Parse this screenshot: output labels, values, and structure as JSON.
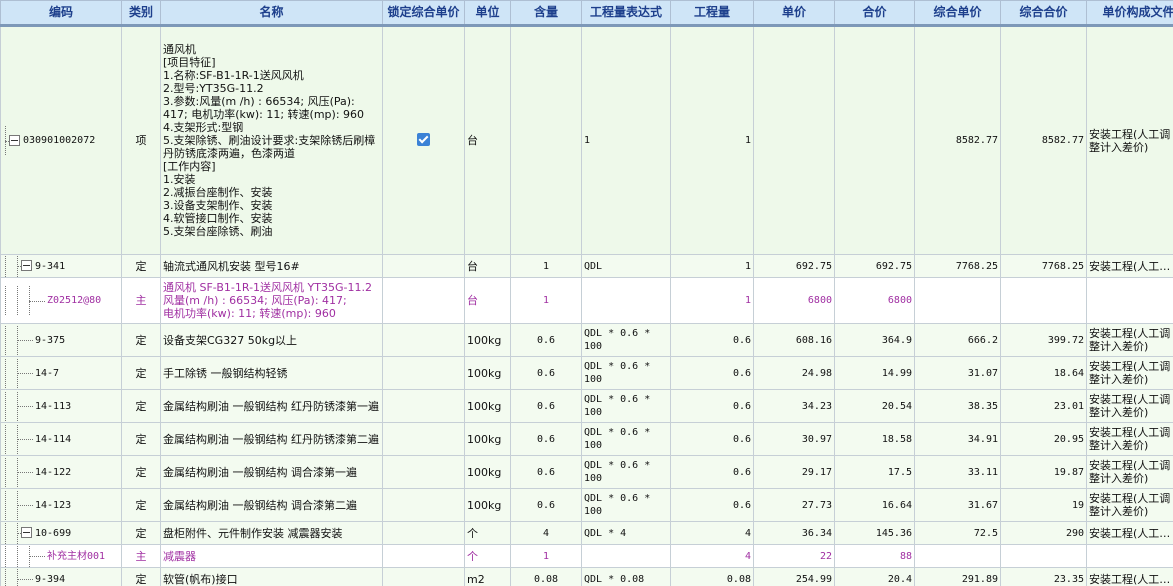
{
  "headers": [
    "编码",
    "类别",
    "名称",
    "锁定综合单价",
    "单位",
    "含量",
    "工程量表达式",
    "工程量",
    "单价",
    "合价",
    "综合单价",
    "综合合价",
    "单价构成文件"
  ],
  "rows": [
    {
      "code": "030901002072",
      "type": "项",
      "name": "通风机\n[项目特征]\n1.名称:SF-B1-1R-1送风风机\n2.型号:YT35G-11.2\n3.参数:风量(m /h)  : 66534; 风压(Pa): 417;  电机功率(kw): 11; 转速(mp): 960\n4.支架形式:型钢\n5.支架除锈、刷油设计要求:支架除锈后刷樟丹防锈底漆两遍，色漆两道\n[工作内容]\n1.安装\n2.减振台座制作、安装\n3.设备支架制作、安装\n4.软管接口制作、安装\n5.支架台座除锈、刷油",
      "unit": "台",
      "content": "",
      "expr": "1",
      "qty": "1",
      "price": "",
      "total": "",
      "comp_price": "8582.77",
      "comp_total": "8582.77",
      "file": "安装工程(人工调\n整计入差价)",
      "locked": true
    },
    {
      "code": "9-341",
      "type": "定",
      "name": "轴流式通风机安装 型号16#",
      "unit": "台",
      "content": "1",
      "expr": "QDL",
      "qty": "1",
      "price": "692.75",
      "total": "692.75",
      "comp_price": "7768.25",
      "comp_total": "7768.25",
      "file": "安装工程(人工…"
    },
    {
      "code": "Z02512@80",
      "type": "主",
      "name": "通风机 SF-B1-1R-1送风风机 YT35G-11.2\n风量(m /h)  : 66534; 风压(Pa): 417;\n电机功率(kw): 11; 转速(mp): 960",
      "unit": "台",
      "content": "1",
      "expr": "",
      "qty": "1",
      "price": "6800",
      "total": "6800",
      "comp_price": "",
      "comp_total": "",
      "file": ""
    },
    {
      "code": "9-375",
      "type": "定",
      "name": "设备支架CG327 50kg以上",
      "unit": "100kg",
      "content": "0.6",
      "expr": "QDL * 0.6 *\n100",
      "qty": "0.6",
      "price": "608.16",
      "total": "364.9",
      "comp_price": "666.2",
      "comp_total": "399.72",
      "file": "安装工程(人工调\n整计入差价)"
    },
    {
      "code": "14-7",
      "type": "定",
      "name": "手工除锈 一般钢结构轻锈",
      "unit": "100kg",
      "content": "0.6",
      "expr": "QDL * 0.6 *\n100",
      "qty": "0.6",
      "price": "24.98",
      "total": "14.99",
      "comp_price": "31.07",
      "comp_total": "18.64",
      "file": "安装工程(人工调\n整计入差价)"
    },
    {
      "code": "14-113",
      "type": "定",
      "name": "金属结构刷油 一般钢结构 红丹防锈漆第一遍",
      "unit": "100kg",
      "content": "0.6",
      "expr": "QDL * 0.6 *\n100",
      "qty": "0.6",
      "price": "34.23",
      "total": "20.54",
      "comp_price": "38.35",
      "comp_total": "23.01",
      "file": "安装工程(人工调\n整计入差价)"
    },
    {
      "code": "14-114",
      "type": "定",
      "name": "金属结构刷油 一般钢结构 红丹防锈漆第二遍",
      "unit": "100kg",
      "content": "0.6",
      "expr": "QDL * 0.6 *\n100",
      "qty": "0.6",
      "price": "30.97",
      "total": "18.58",
      "comp_price": "34.91",
      "comp_total": "20.95",
      "file": "安装工程(人工调\n整计入差价)"
    },
    {
      "code": "14-122",
      "type": "定",
      "name": "金属结构刷油 一般钢结构 调合漆第一遍",
      "unit": "100kg",
      "content": "0.6",
      "expr": "QDL * 0.6 *\n100",
      "qty": "0.6",
      "price": "29.17",
      "total": "17.5",
      "comp_price": "33.11",
      "comp_total": "19.87",
      "file": "安装工程(人工调\n整计入差价)"
    },
    {
      "code": "14-123",
      "type": "定",
      "name": "金属结构刷油 一般钢结构 调合漆第二遍",
      "unit": "100kg",
      "content": "0.6",
      "expr": "QDL * 0.6 *\n100",
      "qty": "0.6",
      "price": "27.73",
      "total": "16.64",
      "comp_price": "31.67",
      "comp_total": "19",
      "file": "安装工程(人工调\n整计入差价)"
    },
    {
      "code": "10-699",
      "type": "定",
      "name": "盘柜附件、元件制作安装 减震器安装",
      "unit": "个",
      "content": "4",
      "expr": "QDL * 4",
      "qty": "4",
      "price": "36.34",
      "total": "145.36",
      "comp_price": "72.5",
      "comp_total": "290",
      "file": "安装工程(人工…"
    },
    {
      "code": "补充主材001",
      "type": "主",
      "name": "减震器",
      "unit": "个",
      "content": "1",
      "expr": "",
      "qty": "4",
      "price": "22",
      "total": "88",
      "comp_price": "",
      "comp_total": "",
      "file": ""
    },
    {
      "code": "9-394",
      "type": "定",
      "name": "软管(帆布)接口",
      "unit": "m2",
      "content": "0.08",
      "expr": "QDL * 0.08",
      "qty": "0.08",
      "price": "254.99",
      "total": "20.4",
      "comp_price": "291.89",
      "comp_total": "23.35",
      "file": "安装工程(人工…"
    }
  ]
}
